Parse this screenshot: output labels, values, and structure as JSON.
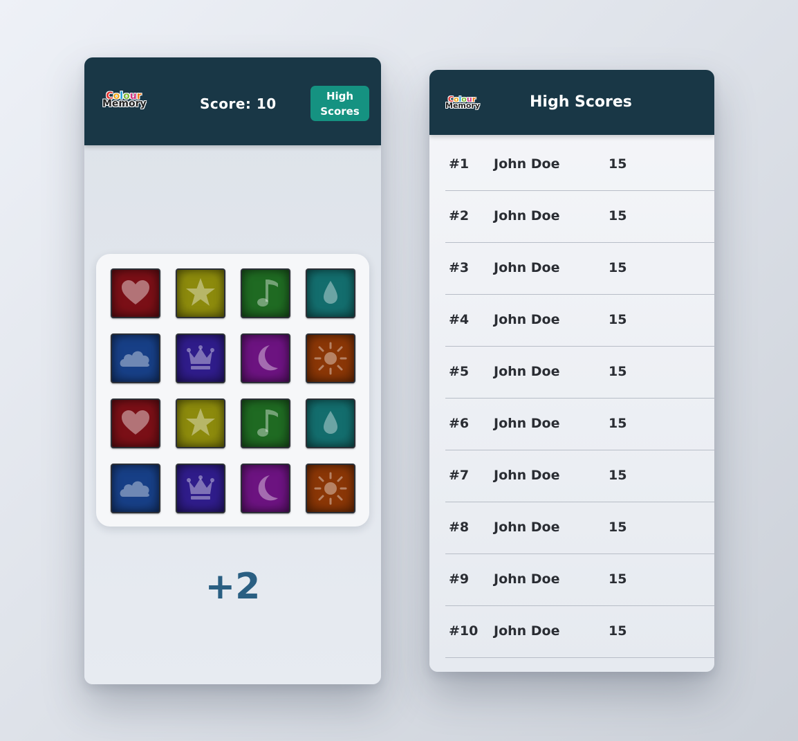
{
  "game": {
    "score_label": "Score: 10",
    "high_scores_button": [
      "High",
      "Scores"
    ],
    "bonus": "+2",
    "logo": {
      "line1": [
        "C",
        "o",
        "l",
        "o",
        "u",
        "r"
      ],
      "line2": "Memory"
    },
    "cards": [
      {
        "color": "#7a0f16",
        "icon": "heart-icon"
      },
      {
        "color": "#8c8a0c",
        "icon": "star-icon"
      },
      {
        "color": "#1f6a22",
        "icon": "music-note-icon"
      },
      {
        "color": "#136d6d",
        "icon": "water-drop-icon"
      },
      {
        "color": "#173f86",
        "icon": "cloud-icon"
      },
      {
        "color": "#2f1c8a",
        "icon": "crown-icon"
      },
      {
        "color": "#6c1380",
        "icon": "moon-icon"
      },
      {
        "color": "#8a3606",
        "icon": "sun-icon"
      },
      {
        "color": "#7a0f16",
        "icon": "heart-icon"
      },
      {
        "color": "#8c8a0c",
        "icon": "star-icon"
      },
      {
        "color": "#1f6a22",
        "icon": "music-note-icon"
      },
      {
        "color": "#136d6d",
        "icon": "water-drop-icon"
      },
      {
        "color": "#173f86",
        "icon": "cloud-icon"
      },
      {
        "color": "#2f1c8a",
        "icon": "crown-icon"
      },
      {
        "color": "#6c1380",
        "icon": "moon-icon"
      },
      {
        "color": "#8a3606",
        "icon": "sun-icon"
      }
    ]
  },
  "high_scores": {
    "title": "High Scores",
    "rows": [
      {
        "rank": "#1",
        "name": "John Doe",
        "score": "15"
      },
      {
        "rank": "#2",
        "name": "John Doe",
        "score": "15"
      },
      {
        "rank": "#3",
        "name": "John Doe",
        "score": "15"
      },
      {
        "rank": "#4",
        "name": "John Doe",
        "score": "15"
      },
      {
        "rank": "#5",
        "name": "John Doe",
        "score": "15"
      },
      {
        "rank": "#6",
        "name": "John Doe",
        "score": "15"
      },
      {
        "rank": "#7",
        "name": "John Doe",
        "score": "15"
      },
      {
        "rank": "#8",
        "name": "John Doe",
        "score": "15"
      },
      {
        "rank": "#9",
        "name": "John Doe",
        "score": "15"
      },
      {
        "rank": "#10",
        "name": "John Doe",
        "score": "15"
      }
    ]
  },
  "colors": {
    "header": "#193746",
    "button": "#159281",
    "bonus": "#2a5f82"
  }
}
